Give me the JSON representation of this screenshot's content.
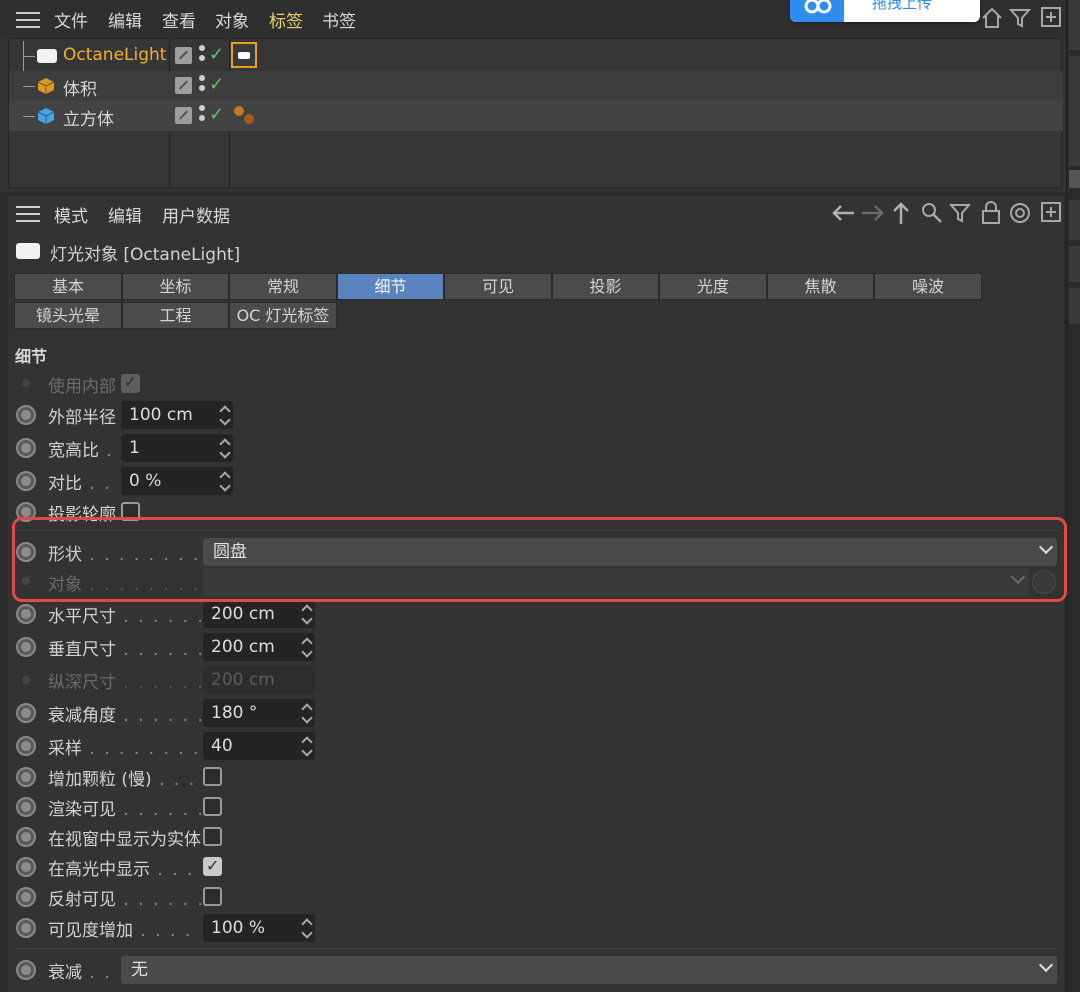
{
  "object_manager": {
    "menu": [
      "文件",
      "编辑",
      "查看",
      "对象",
      "标签",
      "书签"
    ],
    "objects": [
      {
        "name": "OctaneLight",
        "active": true
      },
      {
        "name": "体积",
        "active": false
      },
      {
        "name": "立方体",
        "active": false
      }
    ],
    "cloud_button": "拖拽上传"
  },
  "attribute_manager": {
    "menu": [
      "模式",
      "编辑",
      "用户数据"
    ],
    "title": "灯光对象 [OctaneLight]",
    "tabs_row1": [
      "基本",
      "坐标",
      "常规",
      "细节",
      "可见",
      "投影",
      "光度",
      "焦散",
      "噪波"
    ],
    "tabs_row2": [
      "镜头光晕",
      "工程",
      "OC 灯光标签"
    ],
    "active_tab": "细节",
    "section_title": "细节",
    "params": {
      "use_inner": "使用内部",
      "outer_radius": {
        "label": "外部半径",
        "value": "100 cm"
      },
      "aspect": {
        "label": "宽高比",
        "value": "1"
      },
      "contrast": {
        "label": "对比",
        "value": "0 %"
      },
      "shadow_caster": "投影轮廓",
      "shape": {
        "label": "形状",
        "value": "圆盘"
      },
      "object": {
        "label": "对象",
        "value": ""
      },
      "h_size": {
        "label": "水平尺寸",
        "value": "200 cm"
      },
      "v_size": {
        "label": "垂直尺寸",
        "value": "200 cm"
      },
      "d_size": {
        "label": "纵深尺寸",
        "value": "200 cm"
      },
      "falloff_angle": {
        "label": "衰减角度",
        "value": "180 °"
      },
      "samples": {
        "label": "采样",
        "value": "40"
      },
      "add_grain": "增加颗粒 (慢)",
      "render_visible": "渲染可见",
      "show_solid": "在视窗中显示为实体",
      "show_specular": "在高光中显示",
      "reflect_visible": "反射可见",
      "visibility_boost": {
        "label": "可见度增加",
        "value": "100 %"
      },
      "falloff": {
        "label": "衰减",
        "value": "无"
      }
    }
  },
  "colors": {
    "accent_tab": "#5b84bf",
    "active_name": "#f0b030",
    "highlight_box": "#e04a4a"
  }
}
